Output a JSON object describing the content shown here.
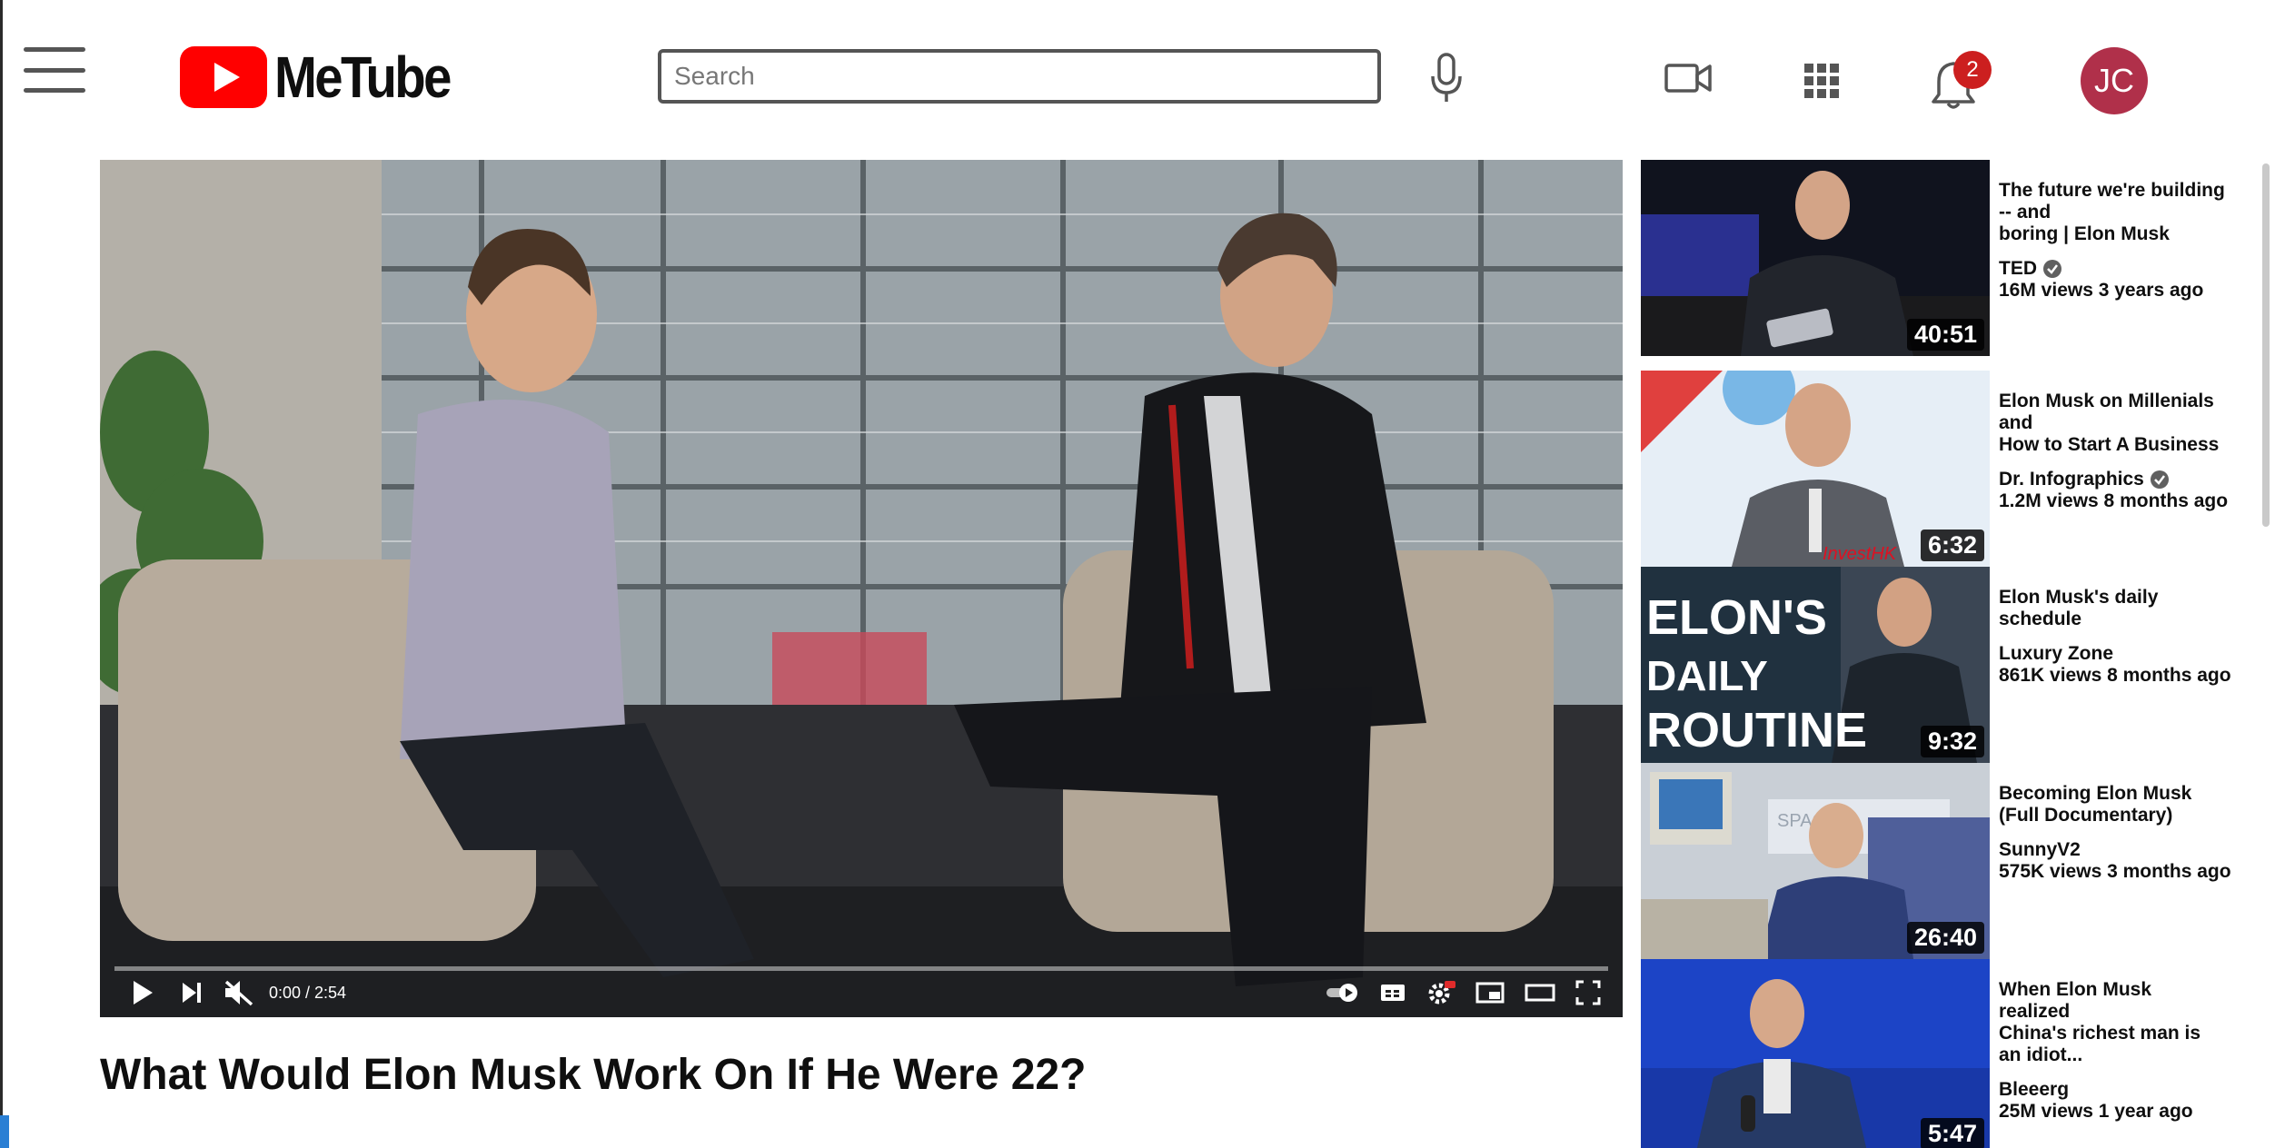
{
  "app": {
    "brand": "MeTube"
  },
  "header": {
    "search_placeholder": "Search",
    "notifications_count": "2",
    "avatar_initials": "JC"
  },
  "player": {
    "time_display": "0:00 / 2:54",
    "progress_fraction": 0.0
  },
  "video": {
    "title": "What Would Elon Musk Work On If He Were 22?"
  },
  "recommendations": [
    {
      "title": "The future we're building\n-- and\nboring | Elon Musk",
      "channel": "TED",
      "verified": true,
      "views": "16M views 3 years ago",
      "duration": "40:51"
    },
    {
      "title": "Elon Musk on Millenials\nand\nHow to Start A Business",
      "channel": "Dr. Infographics",
      "verified": true,
      "views": "1.2M views 8 months ago",
      "duration": "6:32"
    },
    {
      "title": "Elon Musk's daily\nschedule",
      "channel": "Luxury Zone",
      "verified": false,
      "views": "861K views 8 months ago",
      "duration": "9:32"
    },
    {
      "title": "Becoming Elon Musk\n(Full Documentary)",
      "channel": "SunnyV2",
      "verified": false,
      "views": "575K views 3 months ago",
      "duration": "26:40"
    },
    {
      "title": "When Elon Musk\nrealized\nChina's richest man is\nan idiot...",
      "channel": "Bleeerg",
      "verified": false,
      "views": "25M views 1 year ago",
      "duration": "5:47"
    }
  ],
  "thumb_text": {
    "daily_routine": [
      "ELON'S",
      "DAILY",
      "ROUTINE"
    ],
    "spacex": "SPACEX",
    "invest": "InvestHK"
  },
  "colors": {
    "brand_red": "#ff0000",
    "badge_red": "#cc1f1f",
    "avatar": "#b0304a"
  }
}
